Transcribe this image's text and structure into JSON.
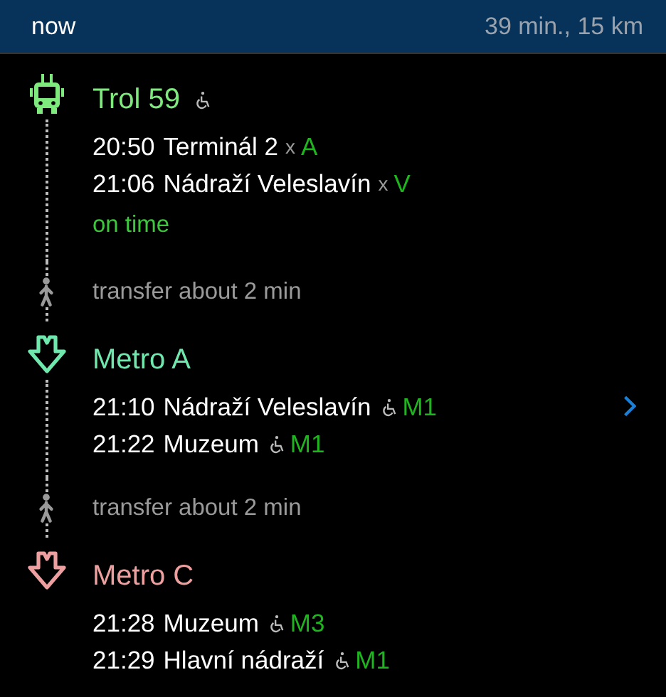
{
  "header": {
    "departure": "now",
    "summary": "39 min., 15 km"
  },
  "legs": [
    {
      "kind": "trolleybus",
      "line": "Trol 59",
      "color": "#7eea7e",
      "accessible": true,
      "details": false,
      "stops": [
        {
          "time": "20:50",
          "name": "Terminál 2",
          "accessible": false,
          "connector": "x",
          "exit": "A"
        },
        {
          "time": "21:06",
          "name": "Nádraží Veleslavín",
          "accessible": false,
          "connector": "x",
          "exit": "V"
        }
      ],
      "status": "on time"
    },
    {
      "kind": "walk",
      "text": "transfer about 2 min"
    },
    {
      "kind": "metro",
      "line": "Metro A",
      "color": "#6fe8ad",
      "accessible": false,
      "details": true,
      "stops": [
        {
          "time": "21:10",
          "name": "Nádraží Veleslavín",
          "accessible": true,
          "exit": "M1"
        },
        {
          "time": "21:22",
          "name": "Muzeum",
          "accessible": true,
          "exit": "M1"
        }
      ]
    },
    {
      "kind": "walk",
      "text": "transfer about 2 min"
    },
    {
      "kind": "metro",
      "line": "Metro C",
      "color": "#eea0a0",
      "accessible": false,
      "details": false,
      "stops": [
        {
          "time": "21:28",
          "name": "Muzeum",
          "accessible": true,
          "exit": "M3"
        },
        {
          "time": "21:29",
          "name": "Hlavní nádraží",
          "accessible": true,
          "exit": "M1"
        }
      ]
    }
  ]
}
